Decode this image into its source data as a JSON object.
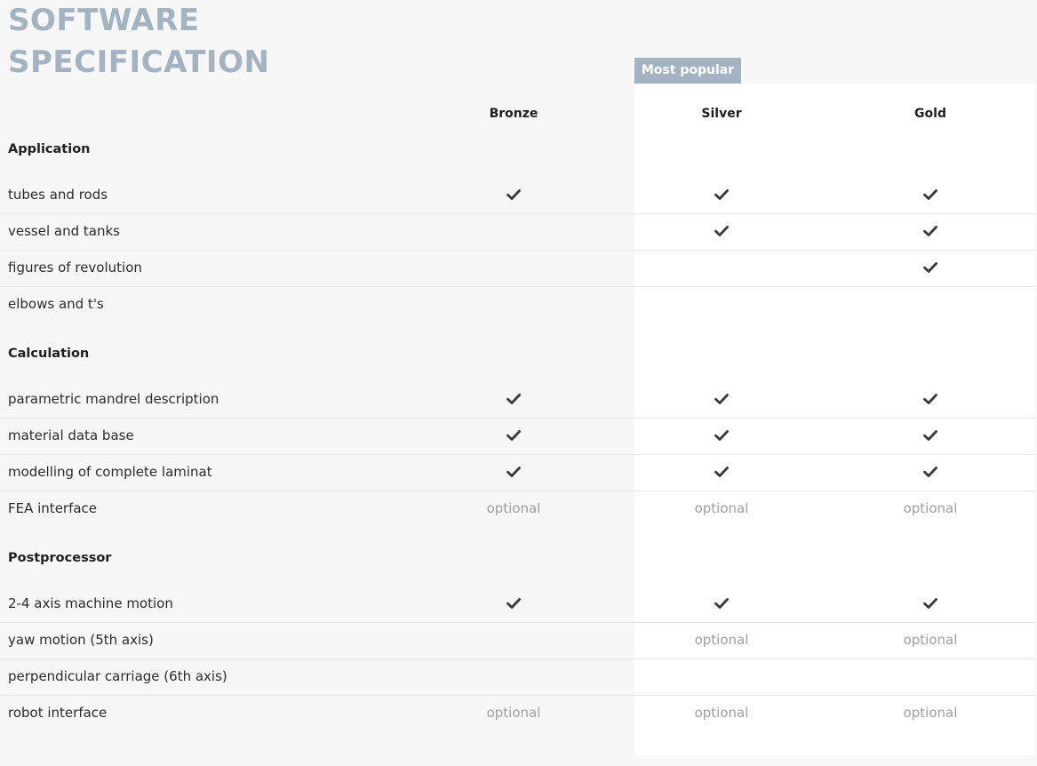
{
  "title": {
    "line1": "SOFTWARE",
    "line2": "SPECIFICATION"
  },
  "badge": "Most popular",
  "columns": [
    "Bronze",
    "Silver",
    "Gold"
  ],
  "sections": [
    {
      "name": "Application",
      "rows": [
        {
          "label": "tubes and rods",
          "values": [
            "check",
            "check",
            "check"
          ]
        },
        {
          "label": "vessel and tanks",
          "values": [
            "",
            "check",
            "check"
          ]
        },
        {
          "label": "figures of revolution",
          "values": [
            "",
            "",
            "check"
          ]
        },
        {
          "label": "elbows and t's",
          "values": [
            "",
            "",
            ""
          ]
        }
      ]
    },
    {
      "name": "Calculation",
      "rows": [
        {
          "label": "parametric mandrel description",
          "values": [
            "check",
            "check",
            "check"
          ]
        },
        {
          "label": "material data base",
          "values": [
            "check",
            "check",
            "check"
          ]
        },
        {
          "label": "modelling of complete laminat",
          "values": [
            "check",
            "check",
            "check"
          ]
        },
        {
          "label": "FEA interface",
          "values": [
            "optional",
            "optional",
            "optional"
          ]
        }
      ]
    },
    {
      "name": "Postprocessor",
      "rows": [
        {
          "label": "2-4 axis machine motion",
          "values": [
            "check",
            "check",
            "check"
          ]
        },
        {
          "label": "yaw motion (5th axis)",
          "values": [
            "",
            "optional",
            "optional"
          ]
        },
        {
          "label": "perpendicular carriage (6th axis)",
          "values": [
            "",
            "",
            ""
          ]
        },
        {
          "label": "robot interface",
          "values": [
            "optional",
            "optional",
            "optional"
          ]
        }
      ]
    }
  ],
  "icons": {
    "check": "check-icon"
  },
  "colors": {
    "accent": "#a3b3c1",
    "optional_text": "#a0a0a0",
    "check": "#3a3a3a"
  }
}
